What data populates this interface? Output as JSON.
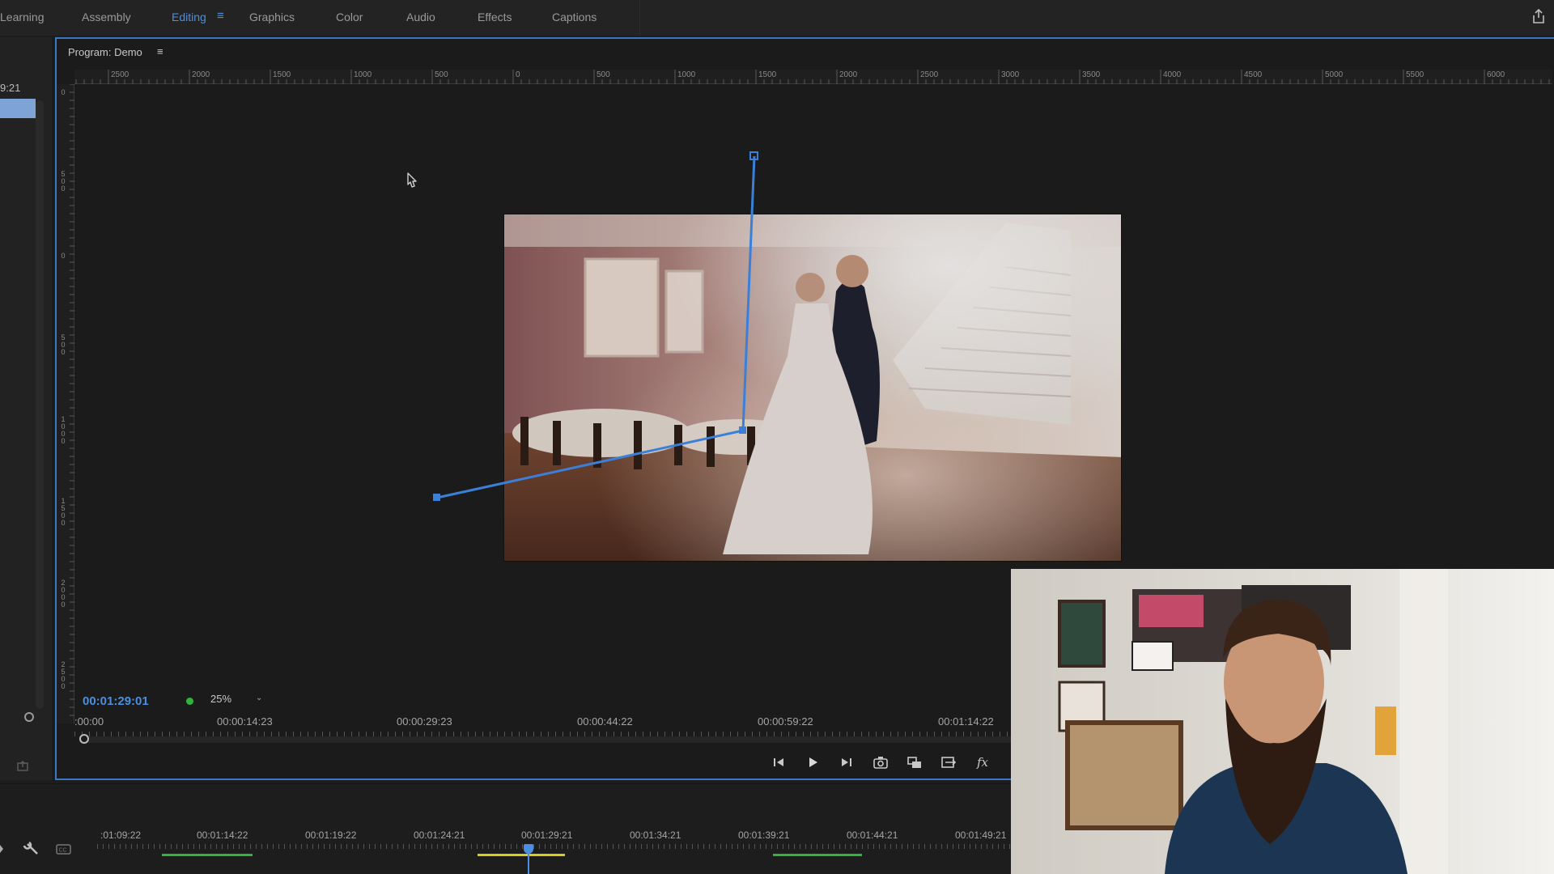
{
  "workspaces": {
    "tabs": [
      "Learning",
      "Assembly",
      "Editing",
      "Graphics",
      "Color",
      "Audio",
      "Effects",
      "Captions"
    ],
    "active": "Editing"
  },
  "left_panel": {
    "timecode": "9:21"
  },
  "program": {
    "title": "Program: Demo",
    "ruler_h_labels": [
      "2500",
      "2000",
      "1500",
      "1000",
      "500",
      "0",
      "500",
      "1000",
      "1500",
      "2000",
      "2500",
      "3000",
      "3500",
      "4000",
      "4500",
      "5000",
      "5500",
      "6000"
    ],
    "ruler_v_labels": [
      "0",
      "500",
      "0",
      "500",
      "1000",
      "1500",
      "2000",
      "2500"
    ],
    "timecode": "00:01:29:01",
    "zoom": "25%",
    "mini_ruler": [
      ":00:00",
      "00:00:14:23",
      "00:00:29:23",
      "00:00:44:22",
      "00:00:59:22",
      "00:01:14:22"
    ],
    "transport": {
      "step_back": "◀|",
      "play": "▶",
      "step_forward": "|▶",
      "export_frame": "camera",
      "insert": "insert",
      "overwrite": "overwrite",
      "fx": "fx"
    }
  },
  "timeline": {
    "ruler": [
      ":01:09:22",
      "00:01:14:22",
      "00:01:19:22",
      "00:01:24:21",
      "00:01:29:21",
      "00:01:34:21",
      "00:01:39:21",
      "00:01:44:21",
      "00:01:49:21"
    ],
    "colors": {
      "render_green": "#2fb63a",
      "render_yellow": "#d8cc1c",
      "playhead": "#4a8fe0"
    }
  },
  "colors": {
    "accent": "#4a8fe0",
    "panel_border": "#3b77c4"
  }
}
